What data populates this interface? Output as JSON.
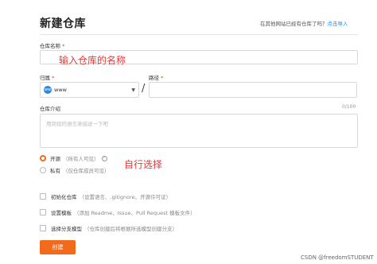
{
  "page": {
    "title": "新建仓库"
  },
  "import": {
    "prefix": "在其他网站已经有仓库了吗？",
    "link": "点击导入"
  },
  "repo_name": {
    "label": "仓库名称",
    "required_mark": "*",
    "value": "",
    "annotation": "输入仓库的名称"
  },
  "owner": {
    "label": "归属",
    "required_mark": "*",
    "avatar_text": "ww",
    "value": "www"
  },
  "path": {
    "label": "路径",
    "required_mark": "*",
    "value": ""
  },
  "slash": "/",
  "description": {
    "label": "仓库介绍",
    "counter": "0/100",
    "placeholder": "用简短的语言来描述一下吧"
  },
  "visibility": {
    "annotation": "自行选择",
    "options": [
      {
        "label": "开源",
        "hint": "（所有人可见）",
        "selected": true,
        "help": "?"
      },
      {
        "label": "私有",
        "hint": "（仅仓库成员可见）",
        "selected": false
      }
    ]
  },
  "init_options": [
    {
      "label": "初始化仓库",
      "hint": "（设置语言、.gitignore、开源许可证）"
    },
    {
      "label": "设置模板",
      "hint": "（添加 Readme、Issue、Pull Request 模板文件）"
    },
    {
      "label": "选择分支模型",
      "hint": "（仓库创建后将根据所选模型创建分支）"
    }
  ],
  "actions": {
    "create": "创建"
  },
  "watermark": "CSDN @freedomSTUDENT",
  "colors": {
    "accent": "#f26b1d",
    "link": "#1e88e5",
    "annotation_red": "#e53935"
  }
}
